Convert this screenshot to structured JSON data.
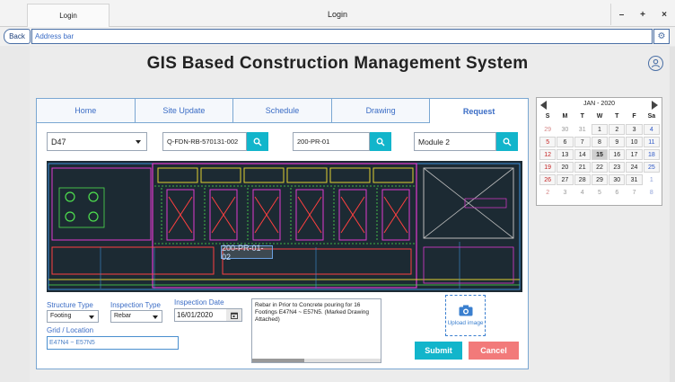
{
  "window": {
    "tab_label": "Login",
    "title": "Login",
    "controls": {
      "minimize": "–",
      "maximize": "+",
      "close": "×"
    }
  },
  "address": {
    "back_label": "Back",
    "placeholder": "Address bar"
  },
  "app": {
    "title": "GIS Based Construction Management System"
  },
  "nav": {
    "tabs": [
      {
        "label": "Home",
        "active": false
      },
      {
        "label": "Site Update",
        "active": false
      },
      {
        "label": "Schedule",
        "active": false
      },
      {
        "label": "Drawing",
        "active": false
      },
      {
        "label": "Request",
        "active": true
      }
    ]
  },
  "filters": {
    "project": "D47",
    "drawing_no": "Q-FDN-RB-570131-002",
    "element_no": "200-PR-01",
    "module": "Module 2"
  },
  "drawing": {
    "callout": "200-PR-01-02"
  },
  "form": {
    "structure_type_label": "Structure Type",
    "structure_type_value": "Footing",
    "inspection_type_label": "Inspection Type",
    "inspection_type_value": "Rebar",
    "inspection_date_label": "Inspection Date",
    "inspection_date_value": "16/01/2020",
    "grid_location_label": "Grid / Location",
    "grid_location_value": "E47N4 ~ E57N5",
    "remarks": "Rebar in Prior to Concrete pouring for 16 Footings E47N4 ~ E57N5. (Marked Drawing Attached)",
    "upload_label": "Upload image",
    "submit_label": "Submit",
    "cancel_label": "Cancel"
  },
  "calendar": {
    "month_label": "JAN - 2020",
    "weekdays": [
      "S",
      "M",
      "T",
      "W",
      "T",
      "F",
      "Sa"
    ],
    "weeks": [
      [
        "29",
        "30",
        "31",
        "1",
        "2",
        "3",
        "4"
      ],
      [
        "5",
        "6",
        "7",
        "8",
        "9",
        "10",
        "11"
      ],
      [
        "12",
        "13",
        "14",
        "15",
        "16",
        "17",
        "18"
      ],
      [
        "19",
        "20",
        "21",
        "22",
        "23",
        "24",
        "25"
      ],
      [
        "26",
        "27",
        "28",
        "29",
        "30",
        "31",
        "1"
      ],
      [
        "2",
        "3",
        "4",
        "5",
        "6",
        "7",
        "8"
      ]
    ],
    "selected_day": "15"
  },
  "colors": {
    "accent": "#12b5cb",
    "cancel": "#f27a7a",
    "link": "#3a6cc5"
  }
}
